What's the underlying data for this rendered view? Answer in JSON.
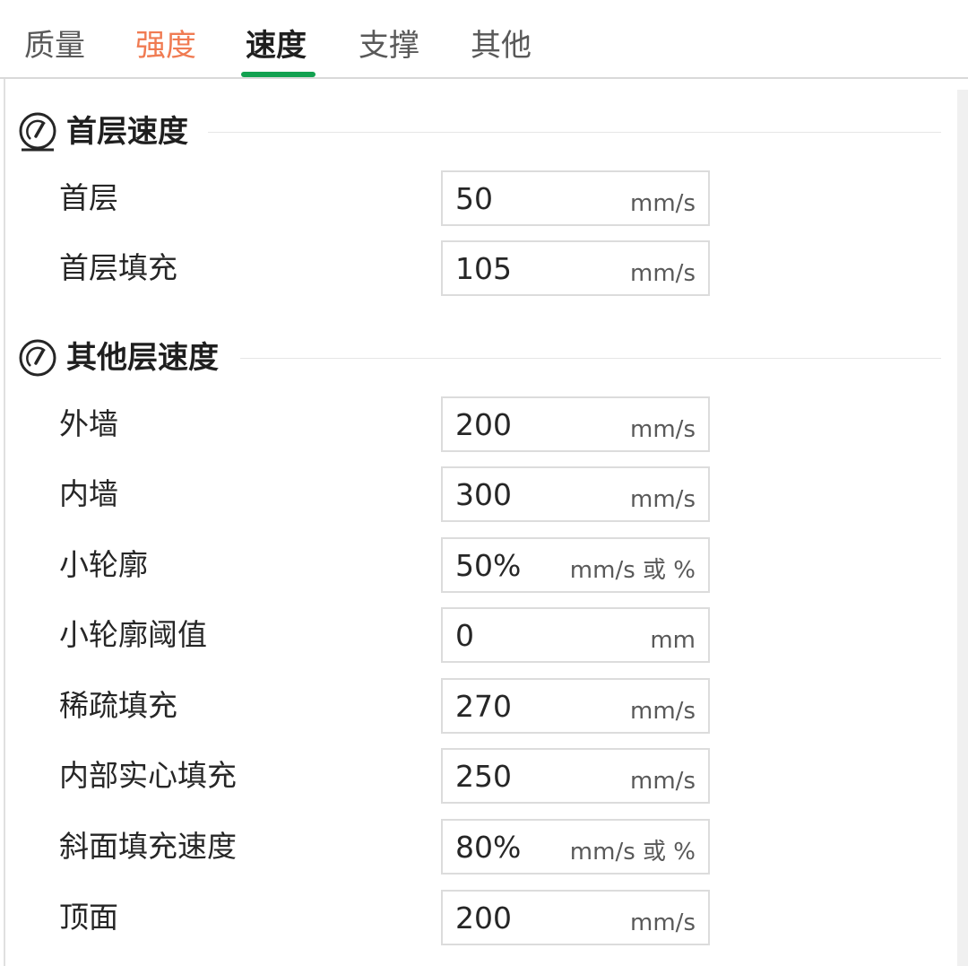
{
  "tabs": [
    {
      "label": "质量",
      "state": "normal"
    },
    {
      "label": "强度",
      "state": "alert"
    },
    {
      "label": "速度",
      "state": "active"
    },
    {
      "label": "支撑",
      "state": "normal"
    },
    {
      "label": "其他",
      "state": "normal"
    }
  ],
  "colors": {
    "alert_tab": "#f07b52",
    "active_indicator": "#12a150"
  },
  "sections": {
    "first_layer": {
      "title": "首层速度",
      "icon": "speedometer-icon",
      "rows": [
        {
          "label": "首层",
          "value": "50",
          "unit": "mm/s"
        },
        {
          "label": "首层填充",
          "value": "105",
          "unit": "mm/s"
        }
      ]
    },
    "other_layers": {
      "title": "其他层速度",
      "icon": "speedometer-icon",
      "rows": [
        {
          "label": "外墙",
          "value": "200",
          "unit": "mm/s"
        },
        {
          "label": "内墙",
          "value": "300",
          "unit": "mm/s"
        },
        {
          "label": "小轮廓",
          "value": "50%",
          "unit": "mm/s 或 %"
        },
        {
          "label": "小轮廓阈值",
          "value": "0",
          "unit": "mm"
        },
        {
          "label": "稀疏填充",
          "value": "270",
          "unit": "mm/s"
        },
        {
          "label": "内部实心填充",
          "value": "250",
          "unit": "mm/s"
        },
        {
          "label": "斜面填充速度",
          "value": "80%",
          "unit": "mm/s 或 %"
        },
        {
          "label": "顶面",
          "value": "200",
          "unit": "mm/s"
        }
      ]
    }
  }
}
